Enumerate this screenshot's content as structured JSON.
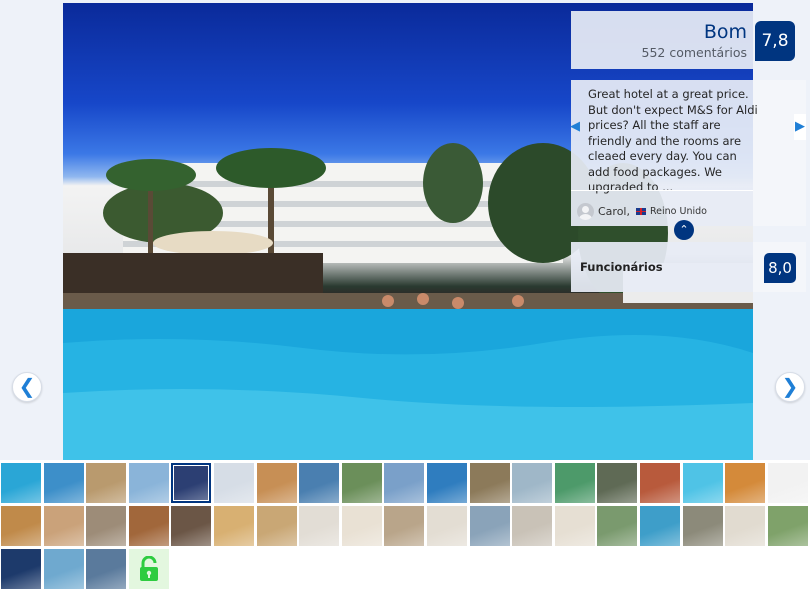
{
  "review": {
    "score_word": "Bom",
    "comment_count": "552 comentários",
    "score": "7,8",
    "text": "Great hotel at a great price. But don't expect M&S for Aldi prices? All the staff are friendly and the rooms are cleaed every day. You can add food packages. We upgraded to ...",
    "reviewer_name": "Carol,",
    "reviewer_country": "Reino Unido"
  },
  "category": {
    "label": "Funcionários",
    "score": "8,0"
  },
  "nav": {
    "prev_glyph": "❮",
    "next_glyph": "❯",
    "review_prev_glyph": "◀",
    "review_next_glyph": "▶",
    "collapse_glyph": "⌃"
  },
  "colors": {
    "accent": "#003580",
    "link": "#1f7fd6",
    "lock": "#2ecc40"
  },
  "thumbnails": [
    "#2aa6d6",
    "#3d8fc9",
    "#b99a6e",
    "#8ab4d9",
    "#2c3f73",
    "#d6dde6",
    "#c78f55",
    "#4a7fb0",
    "#6b8f5a",
    "#7aa0c9",
    "#2f7dbf",
    "#8c7a5a",
    "#9fb7c8",
    "#4d9a6a",
    "#5f6a55",
    "#b85a3c",
    "#4fc3e6",
    "#d48a3a",
    "#f2f2f2",
    "#c08a4a",
    "#caa27a",
    "#9d8c78",
    "#a1673b",
    "#6b5646",
    "#d8b072",
    "#c9a775",
    "#e2ddd5",
    "#e9e1d4",
    "#b9a58a",
    "#e3ddd3",
    "#8aa3b9",
    "#c9c2b7",
    "#e6dfd3",
    "#7a9a6e",
    "#3e9ec9",
    "#8c8a7a",
    "#e1dbd0",
    "#7fa26a",
    "#1d3a6b",
    "#6fa9cf",
    "#5a7a9c"
  ]
}
